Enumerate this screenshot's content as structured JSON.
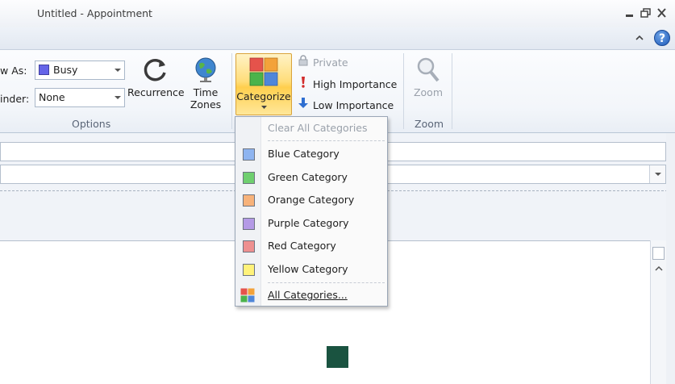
{
  "window": {
    "title": "Untitled - Appointment"
  },
  "ribbon": {
    "options": {
      "show_as_label": "w As:",
      "show_as_value": "Busy",
      "reminder_label": "inder:",
      "reminder_value": "None",
      "recurrence_label": "Recurrence",
      "time_zones_line1": "Time",
      "time_zones_line2": "Zones",
      "group_label": "Options"
    },
    "tags": {
      "categorize_label": "Categorize",
      "private_label": "Private",
      "high_importance_label": "High Importance",
      "low_importance_label": "Low Importance"
    },
    "zoom": {
      "zoom_button_label": "Zoom",
      "group_label": "Zoom"
    }
  },
  "category_menu": {
    "clear_all": "Clear All Categories",
    "items": [
      {
        "label": "Blue Category",
        "color": "#8eb4f0"
      },
      {
        "label": "Green Category",
        "color": "#6fcf6f"
      },
      {
        "label": "Orange Category",
        "color": "#f7b27a"
      },
      {
        "label": "Purple Category",
        "color": "#b49ae6"
      },
      {
        "label": "Red Category",
        "color": "#ee9090"
      },
      {
        "label": "Yellow Category",
        "color": "#fff27a"
      }
    ],
    "all_categories": "All Categories..."
  },
  "colors": {
    "busy": "#6464e8",
    "categorize_highlight": "#ffd866"
  }
}
